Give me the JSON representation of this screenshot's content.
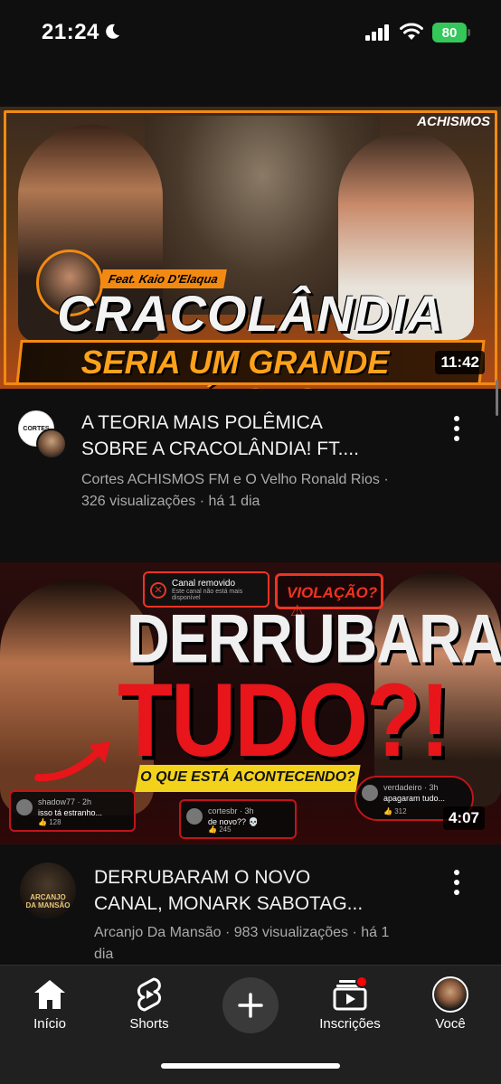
{
  "status_bar": {
    "time": "21:24",
    "battery": "80"
  },
  "videos": [
    {
      "thumbnail": {
        "logo_text": "ACHISMOS",
        "feat_text": "Feat. Kaio D'Elaqua",
        "headline_1": "CRACOLÂNDIA",
        "headline_2": "SERIA UM GRANDE EXÉRCITO",
        "duration": "11:42"
      },
      "title_line1": "A TEORIA MAIS POLÊMICA",
      "title_line2": "SOBRE A CRACOLÂNDIA! FT....",
      "meta_line1": "Cortes ACHISMOS FM e O Velho Ronald Rios ·",
      "meta_line2": "326 visualizações · há 1 dia",
      "channel_avatar_text": "CORTES"
    },
    {
      "thumbnail": {
        "removed_title": "Canal removido",
        "removed_sub": "Este canal não está mais disponível",
        "violation": "VIOLAÇÃO?",
        "headline_1": "DERRUBARAM",
        "headline_2": "TUDO?!",
        "banner": "O QUE ESTÁ ACONTECENDO?",
        "comments": [
          {
            "user": "shadow77 · 2h",
            "text": "isso tá estranho...",
            "likes": "128"
          },
          {
            "user": "cortesbr · 3h",
            "text": "de novo?? 💀",
            "likes": "245"
          },
          {
            "user": "verdadeiro · 3h",
            "text": "apagaram tudo...",
            "likes": "312"
          }
        ],
        "duration": "4:07"
      },
      "title_line1": "DERRUBARAM O NOVO",
      "title_line2": "CANAL, MONARK SABOTAG...",
      "meta_line1": "Arcanjo Da Mansão · 983 visualizações · há 1",
      "meta_line2": "dia",
      "channel_avatar_text": "ARCANJO DA MANSÃO"
    }
  ],
  "bottom_nav": {
    "home": "Início",
    "shorts": "Shorts",
    "subscriptions": "Inscrições",
    "you": "Você"
  },
  "colors": {
    "background": "#0f0f0f",
    "nav_background": "#202020",
    "meta_text": "#aaaaaa",
    "accent_red": "#ff0000"
  }
}
